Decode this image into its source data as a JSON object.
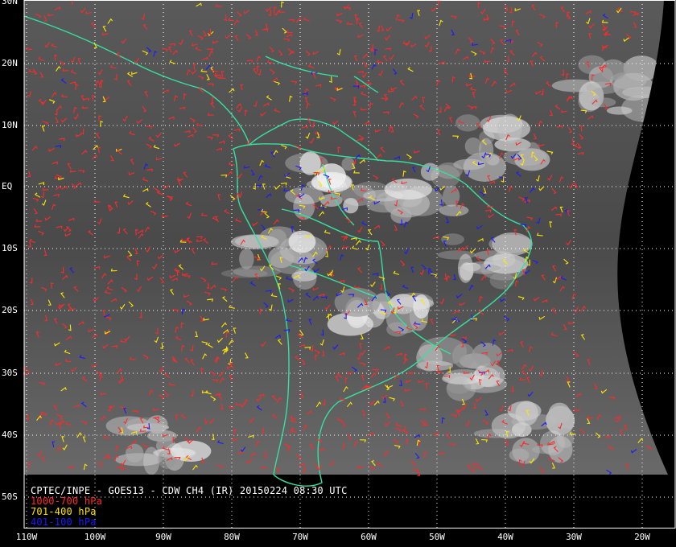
{
  "title": "CPTEC/INPE - GOES13 - CDW CH4 (IR) 20150224 08:30 UTC",
  "legend": [
    {
      "label": "1000-700 hPa",
      "color": "#ff2a2a"
    },
    {
      "label": "701-400 hPa",
      "color": "#ffe600"
    },
    {
      "label": "401-100 hPa",
      "color": "#1a1aff"
    }
  ],
  "map": {
    "extent": {
      "lon_min": -110,
      "lon_max": -15,
      "lat_min": -55,
      "lat_max": 30
    },
    "coastline_color": "#35e0a0",
    "grid_color": "#ffffff",
    "background_color": "#000000"
  },
  "lat_labels": [
    "30N",
    "20N",
    "10N",
    "EQ",
    "10S",
    "20S",
    "30S",
    "40S",
    "50S"
  ],
  "lon_labels": [
    "110W",
    "100W",
    "90W",
    "80W",
    "70W",
    "60W",
    "50W",
    "40W",
    "30W",
    "20W"
  ]
}
